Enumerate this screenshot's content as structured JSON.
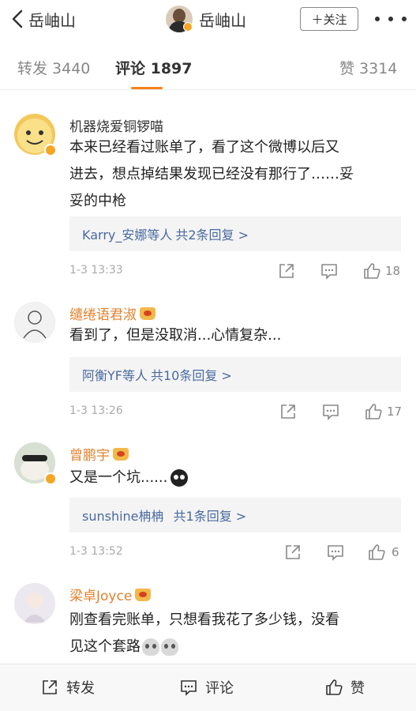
{
  "topbar": {
    "back_label": "岳岫山",
    "user_name": "岳岫山",
    "follow_label": "＋关注"
  },
  "tabs": {
    "repost": "转发 3440",
    "comment": "评论 1897",
    "like": "赞 3314"
  },
  "comments": [
    {
      "user": "机器烧爱铜锣喵",
      "text_lines": [
        "本来已经看过账单了，看了这个微博以后又",
        "进去，想点掉结果发现已经没有那行了……妥",
        "妥的中枪"
      ],
      "reply_users": "Karry_安娜等人",
      "reply_count": "共2条回复 >",
      "time": "1-3 13:33",
      "likes": "18"
    },
    {
      "user": "缱绻语君淑",
      "text_lines": [
        "看到了，但是没取消...心情复杂..."
      ],
      "reply_users": "阿衡YF等人",
      "reply_count": "共10条回复 >",
      "time": "1-3 13:26",
      "likes": "17"
    },
    {
      "user": "曾鹏宇",
      "text_lines": [
        "又是一个坑......"
      ],
      "reply_users": "sunshine柟柟",
      "reply_count": "共1条回复 >",
      "time": "1-3 13:52",
      "likes": "6"
    },
    {
      "user": "梁卓Joyce",
      "text_lines": [
        "刚查看完账单，只想看我花了多少钱，没看",
        "见这个套路"
      ]
    }
  ],
  "bottombar": {
    "repost": "转发",
    "comment": "评论",
    "like": "赞"
  },
  "colors": {
    "accent": "#f7821b",
    "vip_name": "#e0822e",
    "link": "#4a6aa0"
  }
}
